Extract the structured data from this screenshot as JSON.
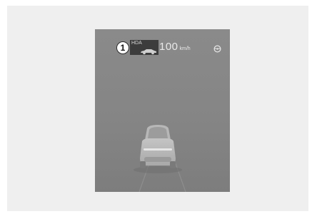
{
  "cluster": {
    "callout_number": "1",
    "hda_label": "HDA",
    "speed_value": "100",
    "speed_unit": "km/h"
  },
  "icons": {
    "hda_car": "car-side-icon",
    "steering": "steering-wheel-icon",
    "lead_vehicle": "vehicle-rear-icon"
  },
  "colors": {
    "frame_background": "#efefef",
    "display_background": "#858585",
    "hda_box": "#3c3c3c",
    "text": "#e9e9e9"
  }
}
